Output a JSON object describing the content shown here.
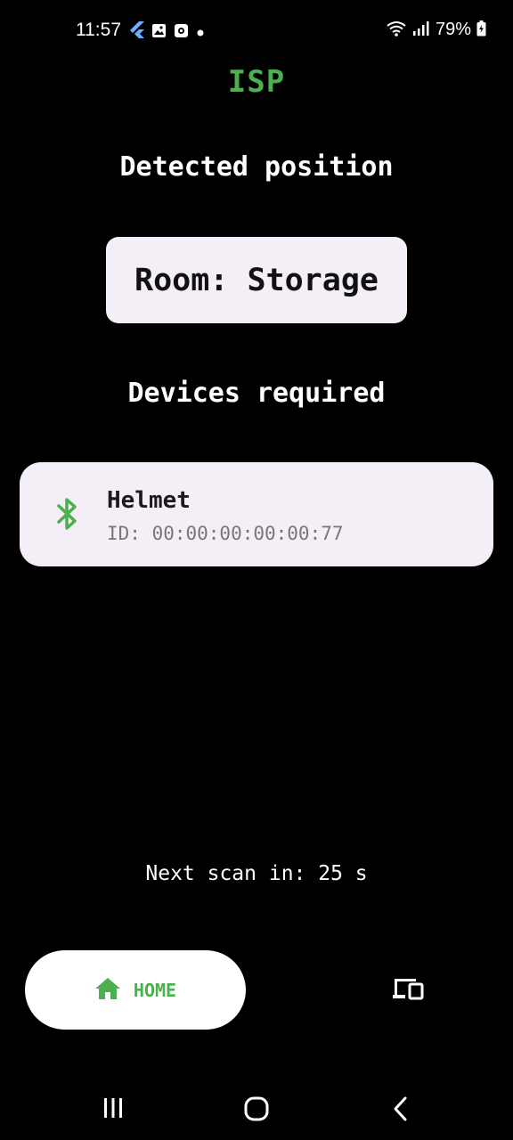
{
  "status_bar": {
    "time": "11:57",
    "battery": "79%",
    "icons": [
      "flutter-icon",
      "image-icon",
      "screenshot-icon",
      "dot-icon",
      "wifi-icon",
      "signal-icon",
      "battery-icon"
    ]
  },
  "app": {
    "title": "ISP",
    "accent_color": "#4caf50"
  },
  "position": {
    "heading": "Detected position",
    "room": "Room: Storage"
  },
  "devices": {
    "heading": "Devices required",
    "items": [
      {
        "name": "Helmet",
        "id": "ID: 00:00:00:00:00:77",
        "icon": "bluetooth-icon"
      }
    ]
  },
  "scan": {
    "text": "Next scan in: 25 s"
  },
  "bottom_nav": {
    "home_label": "HOME",
    "items": [
      "home-icon",
      "devices-icon"
    ]
  },
  "system_nav": {
    "buttons": [
      "recents-icon",
      "home-circle-icon",
      "back-icon"
    ]
  }
}
